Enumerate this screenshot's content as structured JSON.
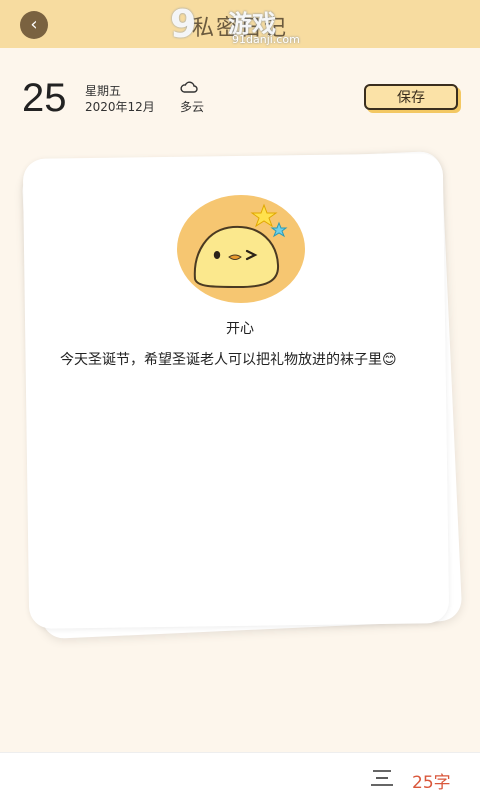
{
  "header": {
    "title": "私密日记",
    "back_icon": "back-arrow-icon",
    "watermark": {
      "logo": "9",
      "text": "游戏",
      "url": "91danji.com"
    }
  },
  "date": {
    "day": "25",
    "weekday": "星期五",
    "year_month": "2020年12月",
    "weather_icon": "cloud-icon",
    "weather": "多云"
  },
  "actions": {
    "save_label": "保存"
  },
  "entry": {
    "mood_icon": "happy-chick-icon",
    "mood_label": "开心",
    "text": "今天圣诞节，希望圣诞老人可以把礼物放进的袜子里😊"
  },
  "footer": {
    "menu_icon": "text-align-icon",
    "word_count": "25字"
  },
  "colors": {
    "header_bg": "#f7dca0",
    "page_bg": "#fdf6ec",
    "save_button_bg": "#fbe2a7",
    "mood_circle": "#f6c671",
    "word_count": "#d9573b"
  }
}
